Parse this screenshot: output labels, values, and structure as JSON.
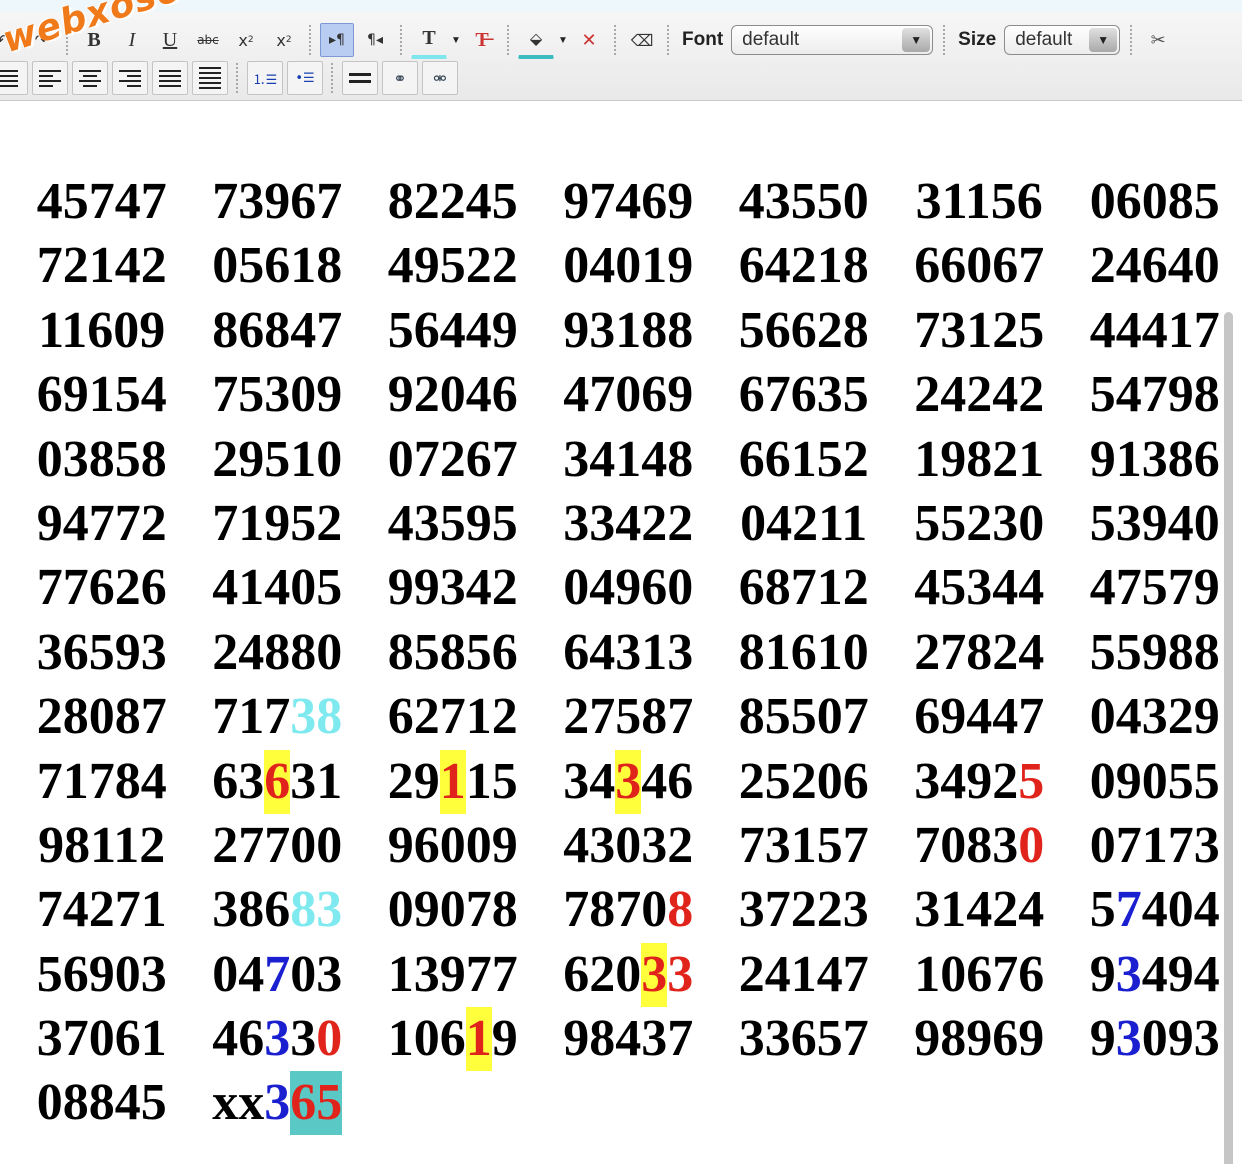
{
  "toolbar": {
    "font_label": "Font",
    "font_value": "default",
    "size_label": "Size",
    "size_value": "default",
    "icons": [
      "undo-icon",
      "redo-icon",
      "bold-icon",
      "italic-icon",
      "underline-icon",
      "strikethrough-icon",
      "subscript-icon",
      "superscript-icon",
      "ltr-icon",
      "rtl-icon",
      "text-color-icon",
      "remove-format-icon",
      "background-color-icon",
      "remove-background-icon",
      "eraser-icon",
      "cut-icon"
    ],
    "row2_icons": [
      "align-justify-left-icon",
      "align-left-icon",
      "align-center-icon",
      "align-right-icon",
      "align-justify-icon",
      "align-full-icon",
      "ordered-list-icon",
      "unordered-list-icon",
      "horizontal-rule-icon",
      "link-icon",
      "unlink-icon"
    ]
  },
  "watermark": "webxoso.net",
  "colors": {
    "black": "#000000",
    "red": "#e0241c",
    "cyan": "#7ee9ef",
    "blue": "#1a1fd0",
    "yellow_highlight": "#ffff3c",
    "teal_highlight": "#5ac8c4"
  },
  "numbers": [
    [
      {
        "t": "45747"
      }
    ],
    [
      {
        "t": "73967"
      }
    ],
    [
      {
        "t": "82245"
      }
    ],
    [
      {
        "t": "97469"
      }
    ],
    [
      {
        "t": "43550"
      }
    ],
    [
      {
        "t": "31156"
      }
    ],
    [
      {
        "t": "06085"
      }
    ],
    [
      {
        "t": "72142"
      }
    ],
    [
      {
        "t": "05618"
      }
    ],
    [
      {
        "t": "49522"
      }
    ],
    [
      {
        "t": "04019"
      }
    ],
    [
      {
        "t": "64218"
      }
    ],
    [
      {
        "t": "66067"
      }
    ],
    [
      {
        "t": "24640"
      }
    ],
    [
      {
        "t": "11609"
      }
    ],
    [
      {
        "t": "86847"
      }
    ],
    [
      {
        "t": "56449"
      }
    ],
    [
      {
        "t": "93188"
      }
    ],
    [
      {
        "t": "56628"
      }
    ],
    [
      {
        "t": "73125"
      }
    ],
    [
      {
        "t": "44417"
      }
    ],
    [
      {
        "t": "69154"
      }
    ],
    [
      {
        "t": "75309"
      }
    ],
    [
      {
        "t": "92046"
      }
    ],
    [
      {
        "t": "47069"
      }
    ],
    [
      {
        "t": "67635"
      }
    ],
    [
      {
        "t": "24242"
      }
    ],
    [
      {
        "t": "54798"
      }
    ],
    [
      {
        "t": "03858"
      }
    ],
    [
      {
        "t": "29510"
      }
    ],
    [
      {
        "t": "07267"
      }
    ],
    [
      {
        "t": "34148"
      }
    ],
    [
      {
        "t": "66152"
      }
    ],
    [
      {
        "t": "19821"
      }
    ],
    [
      {
        "t": "91386"
      }
    ],
    [
      {
        "t": "94772"
      }
    ],
    [
      {
        "t": "71952"
      }
    ],
    [
      {
        "t": "43595"
      }
    ],
    [
      {
        "t": "33422"
      }
    ],
    [
      {
        "t": "04211"
      }
    ],
    [
      {
        "t": "55230"
      }
    ],
    [
      {
        "t": "53940"
      }
    ],
    [
      {
        "t": "77626"
      }
    ],
    [
      {
        "t": "41405"
      }
    ],
    [
      {
        "t": "99342"
      }
    ],
    [
      {
        "t": "04960"
      }
    ],
    [
      {
        "t": "68712"
      }
    ],
    [
      {
        "t": "45344"
      }
    ],
    [
      {
        "t": "47579"
      }
    ],
    [
      {
        "t": "36593"
      }
    ],
    [
      {
        "t": "24880"
      }
    ],
    [
      {
        "t": "85856"
      }
    ],
    [
      {
        "t": "64313"
      }
    ],
    [
      {
        "t": "81610"
      }
    ],
    [
      {
        "t": "27824"
      }
    ],
    [
      {
        "t": "55988"
      }
    ],
    [
      {
        "t": "28087"
      }
    ],
    [
      {
        "t": "717"
      },
      {
        "t": "38",
        "c": "cyan"
      }
    ],
    [
      {
        "t": "62712"
      }
    ],
    [
      {
        "t": "27587"
      }
    ],
    [
      {
        "t": "85507"
      }
    ],
    [
      {
        "t": "69447"
      }
    ],
    [
      {
        "t": "04329"
      }
    ],
    [
      {
        "t": "71784"
      }
    ],
    [
      {
        "t": "63"
      },
      {
        "t": "6",
        "c": "red",
        "hl": "yellow"
      },
      {
        "t": "31"
      }
    ],
    [
      {
        "t": "29"
      },
      {
        "t": "1",
        "c": "red",
        "hl": "yellow"
      },
      {
        "t": "15"
      }
    ],
    [
      {
        "t": "34"
      },
      {
        "t": "3",
        "c": "red",
        "hl": "yellow"
      },
      {
        "t": "46"
      }
    ],
    [
      {
        "t": "25206"
      }
    ],
    [
      {
        "t": "3492"
      },
      {
        "t": "5",
        "c": "red"
      }
    ],
    [
      {
        "t": "09055"
      }
    ],
    [
      {
        "t": "98112"
      }
    ],
    [
      {
        "t": "27700"
      }
    ],
    [
      {
        "t": "96009"
      }
    ],
    [
      {
        "t": "43032"
      }
    ],
    [
      {
        "t": "73157"
      }
    ],
    [
      {
        "t": "7083"
      },
      {
        "t": "0",
        "c": "red"
      }
    ],
    [
      {
        "t": "07173"
      }
    ],
    [
      {
        "t": "74271"
      }
    ],
    [
      {
        "t": "386"
      },
      {
        "t": "83",
        "c": "cyan"
      }
    ],
    [
      {
        "t": "09078"
      }
    ],
    [
      {
        "t": "7870"
      },
      {
        "t": "8",
        "c": "red"
      }
    ],
    [
      {
        "t": "37223"
      }
    ],
    [
      {
        "t": "31424"
      }
    ],
    [
      {
        "t": "5"
      },
      {
        "t": "7",
        "c": "blue"
      },
      {
        "t": "404"
      }
    ],
    [
      {
        "t": "56903"
      }
    ],
    [
      {
        "t": "04"
      },
      {
        "t": "7",
        "c": "blue"
      },
      {
        "t": "03"
      }
    ],
    [
      {
        "t": "13977"
      }
    ],
    [
      {
        "t": "620"
      },
      {
        "t": "3",
        "c": "red",
        "hl": "yellow"
      },
      {
        "t": "3",
        "c": "red"
      }
    ],
    [
      {
        "t": "24147"
      }
    ],
    [
      {
        "t": "10676"
      }
    ],
    [
      {
        "t": "9"
      },
      {
        "t": "3",
        "c": "blue"
      },
      {
        "t": "494"
      }
    ],
    [
      {
        "t": "37061"
      }
    ],
    [
      {
        "t": "46"
      },
      {
        "t": "3",
        "c": "blue"
      },
      {
        "t": "3"
      },
      {
        "t": "0",
        "c": "red"
      }
    ],
    [
      {
        "t": "106"
      },
      {
        "t": "1",
        "c": "red",
        "hl": "yellow"
      },
      {
        "t": "9"
      }
    ],
    [
      {
        "t": "98437"
      }
    ],
    [
      {
        "t": "33657"
      }
    ],
    [
      {
        "t": "98969"
      }
    ],
    [
      {
        "t": "9"
      },
      {
        "t": "3",
        "c": "blue"
      },
      {
        "t": "093"
      }
    ],
    [
      {
        "t": "08845"
      }
    ],
    [
      {
        "t": "xx"
      },
      {
        "t": "3",
        "c": "blue"
      },
      {
        "t": "65",
        "c": "red",
        "hl": "teal"
      }
    ]
  ]
}
